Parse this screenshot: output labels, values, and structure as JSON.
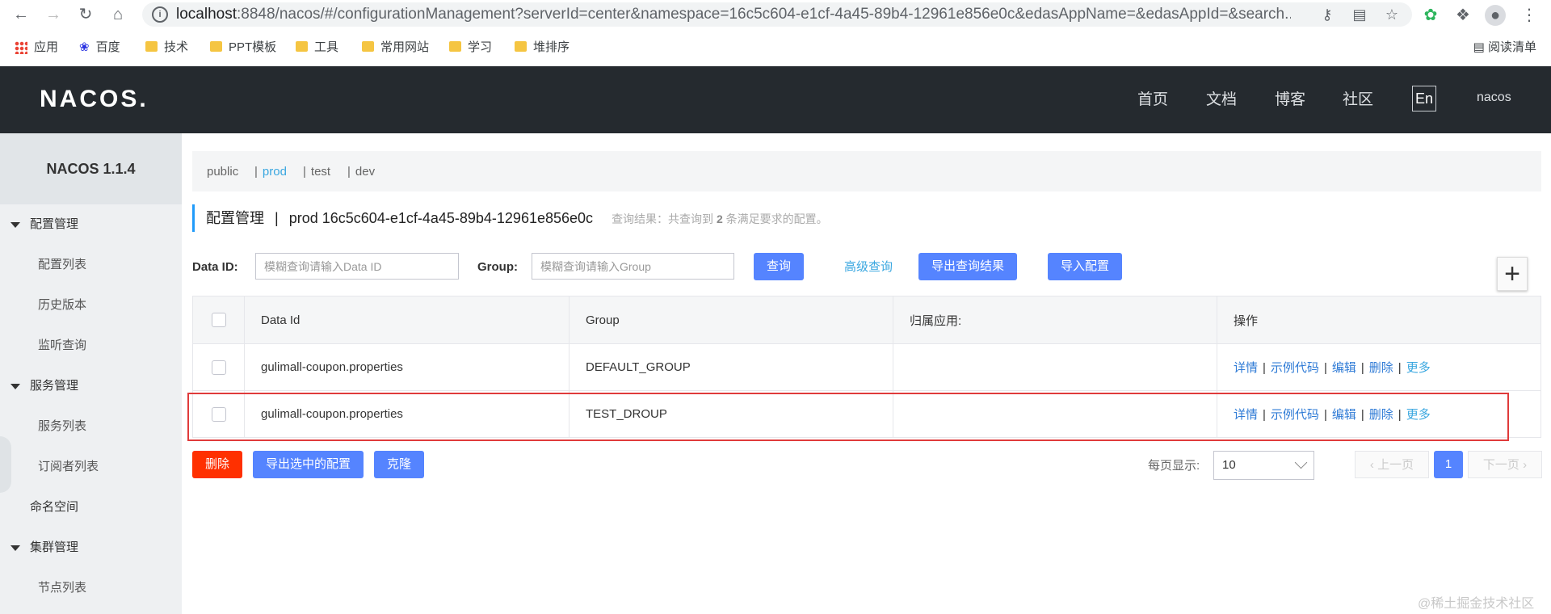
{
  "browser": {
    "url_host": "localhost",
    "url_rest": ":8848/nacos/#/configurationManagement?serverId=center&namespace=16c5c604-e1cf-4a45-89b4-12961e856e0c&edasAppName=&edasAppId=&search...",
    "bookmarks": [
      "应用",
      "百度",
      "技术",
      "PPT模板",
      "工具",
      "常用网站",
      "学习",
      "堆排序"
    ],
    "reading_list": "阅读清单"
  },
  "header": {
    "logo": "NACOS.",
    "nav": [
      "首页",
      "文档",
      "博客",
      "社区"
    ],
    "lang": "En",
    "user": "nacos"
  },
  "sidebar": {
    "title": "NACOS 1.1.4",
    "groups": [
      {
        "label": "配置管理",
        "items": [
          "配置列表",
          "历史版本",
          "监听查询"
        ]
      },
      {
        "label": "服务管理",
        "items": [
          "服务列表",
          "订阅者列表"
        ]
      },
      {
        "label": "命名空间"
      },
      {
        "label": "集群管理",
        "items": [
          "节点列表"
        ]
      }
    ]
  },
  "namespaces": [
    "public",
    "prod",
    "test",
    "dev"
  ],
  "active_namespace": "prod",
  "page": {
    "title": "配置管理",
    "namespace_name": "prod",
    "namespace_id": "16c5c604-e1cf-4a45-89b4-12961e856e0c",
    "hint_prefix": "查询结果：共查询到",
    "hint_count": "2",
    "hint_suffix": "条满足要求的配置。"
  },
  "filter": {
    "data_id_label": "Data ID:",
    "data_id_placeholder": "模糊查询请输入Data ID",
    "group_label": "Group:",
    "group_placeholder": "模糊查询请输入Group",
    "query_btn": "查询",
    "advanced_link": "高级查询",
    "export_btn": "导出查询结果",
    "import_btn": "导入配置",
    "add_icon": "plus-icon"
  },
  "table": {
    "columns": [
      "Data Id",
      "Group",
      "归属应用:",
      "操作"
    ],
    "rows": [
      {
        "data_id": "gulimall-coupon.properties",
        "group": "DEFAULT_GROUP",
        "app": ""
      },
      {
        "data_id": "gulimall-coupon.properties",
        "group": "TEST_DROUP",
        "app": ""
      }
    ],
    "ops": [
      "详情",
      "示例代码",
      "编辑",
      "删除",
      "更多"
    ]
  },
  "bottom": {
    "delete_btn": "删除",
    "export_selected_btn": "导出选中的配置",
    "clone_btn": "克隆",
    "page_size_label": "每页显示:",
    "page_size": "10",
    "prev": "上一页",
    "current_page": "1",
    "next": "下一页"
  },
  "watermark": "@稀土掘金技术社区",
  "colors": {
    "header_bg": "#252a2f",
    "primary": "#5584ff",
    "danger": "#ff3000",
    "link": "#2f7bd6",
    "highlight_box": "#e03b3b"
  }
}
